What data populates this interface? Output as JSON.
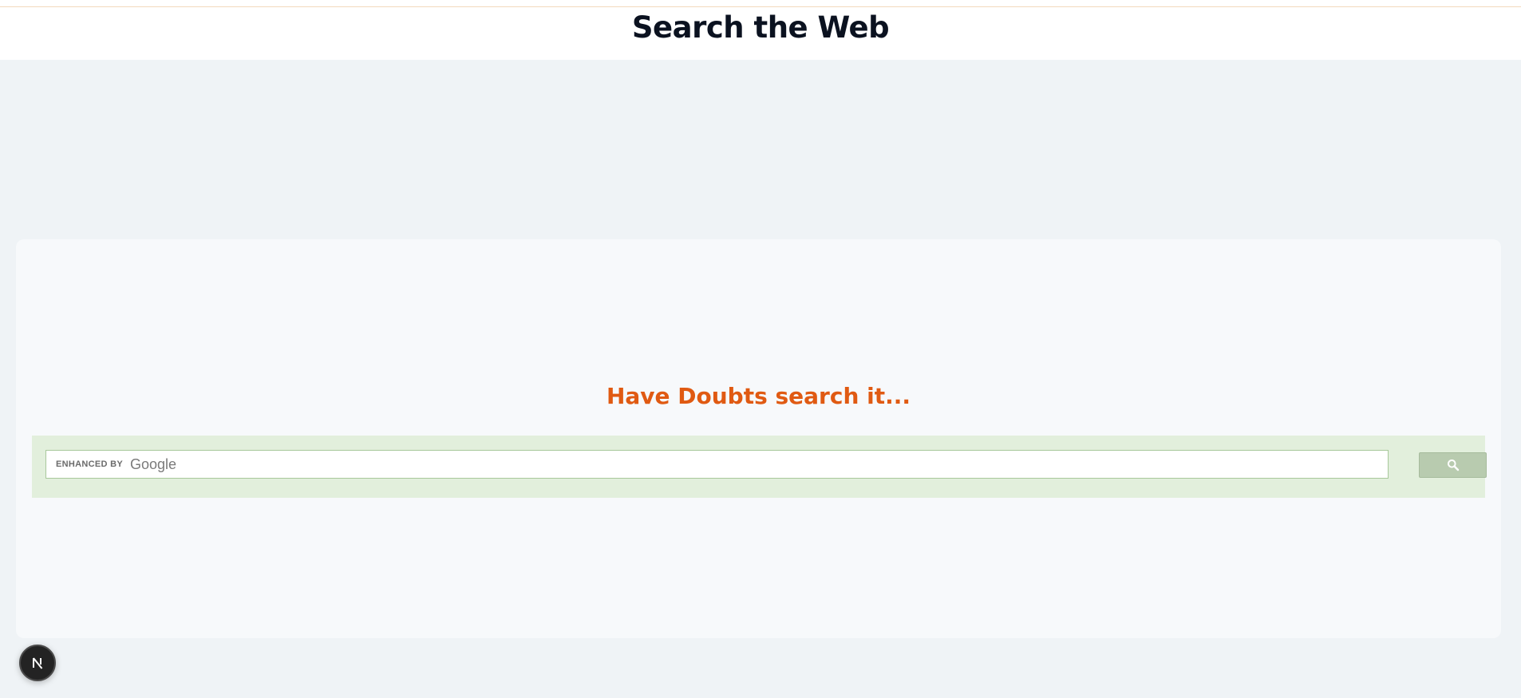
{
  "header": {
    "title": "Search the Web"
  },
  "main": {
    "tagline": "Have Doubts search it..."
  },
  "search": {
    "enhanced_by": "ENHANCED BY",
    "provider": "Google",
    "button_icon": "search-icon"
  },
  "badge": {
    "icon": "next-logo-icon"
  },
  "colors": {
    "tagline": "#e05a12",
    "search_panel": "#e2efdc",
    "search_button": "#b8cbaf",
    "page_background": "#eff3f6"
  }
}
